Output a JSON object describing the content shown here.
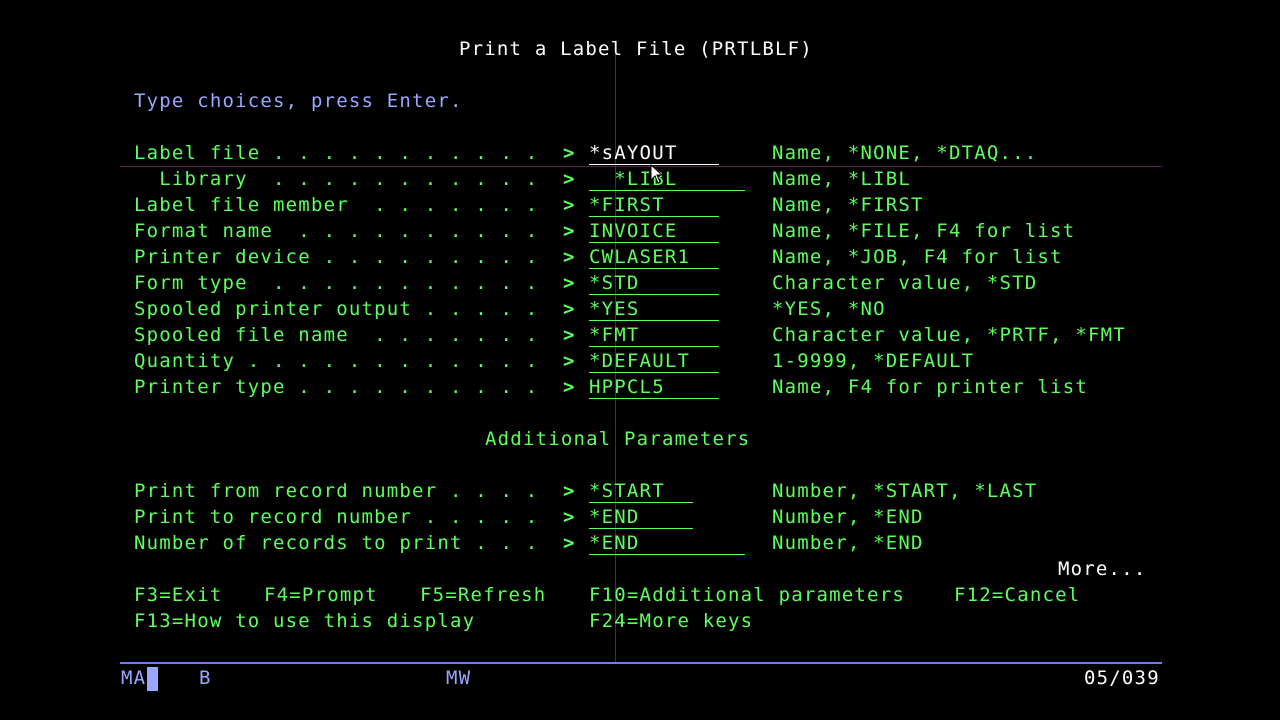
{
  "screen": {
    "title": "Print a Label File (PRTLBLF)",
    "instruction": "Type choices, press Enter.",
    "section_header": "Additional Parameters",
    "more": "More..."
  },
  "params": [
    {
      "label": "Label file . . . . . . . . . . .",
      "value": "*sAYOUT",
      "hint": "Name, *NONE, *DTAQ..."
    },
    {
      "label": "  Library  . . . . . . . . . . .",
      "value": "  *LIBL",
      "hint": "Name, *LIBL"
    },
    {
      "label": "Label file member  . . . . . . .",
      "value": "*FIRST",
      "hint": "Name, *FIRST"
    },
    {
      "label": "Format name  . . . . . . . . . .",
      "value": "INVOICE",
      "hint": "Name, *FILE, F4 for list"
    },
    {
      "label": "Printer device . . . . . . . . .",
      "value": "CWLASER1",
      "hint": "Name, *JOB, F4 for list"
    },
    {
      "label": "Form type  . . . . . . . . . . .",
      "value": "*STD",
      "hint": "Character value, *STD"
    },
    {
      "label": "Spooled printer output . . . . .",
      "value": "*YES",
      "hint": "*YES, *NO"
    },
    {
      "label": "Spooled file name  . . . . . . .",
      "value": "*FMT",
      "hint": "Character value, *PRTF, *FMT"
    },
    {
      "label": "Quantity . . . . . . . . . . . .",
      "value": "*DEFAULT",
      "hint": "1-9999, *DEFAULT"
    },
    {
      "label": "Printer type . . . . . . . . . .",
      "value": "HPPCL5",
      "hint": "Name, F4 for printer list"
    }
  ],
  "additional_params": [
    {
      "label": "Print from record number . . . .",
      "value": "*START",
      "hint": "Number, *START, *LAST"
    },
    {
      "label": "Print to record number . . . . .",
      "value": "*END",
      "hint": "Number, *END"
    },
    {
      "label": "Number of records to print . . .",
      "value": "*END",
      "hint": "Number, *END"
    }
  ],
  "chevron": ">",
  "fkeys": {
    "f3": "F3=Exit",
    "f4": "F4=Prompt",
    "f5": "F5=Refresh",
    "f10": "F10=Additional parameters",
    "f12": "F12=Cancel",
    "f13": "F13=How to use this display",
    "f24": "F24=More keys"
  },
  "status": {
    "ma": "MA",
    "b": "B",
    "mw": "MW",
    "position": "05/039"
  },
  "colors": {
    "green": "#5cff5c",
    "blue": "#9aa6ff",
    "white": "#ffffff",
    "background": "#000000"
  }
}
